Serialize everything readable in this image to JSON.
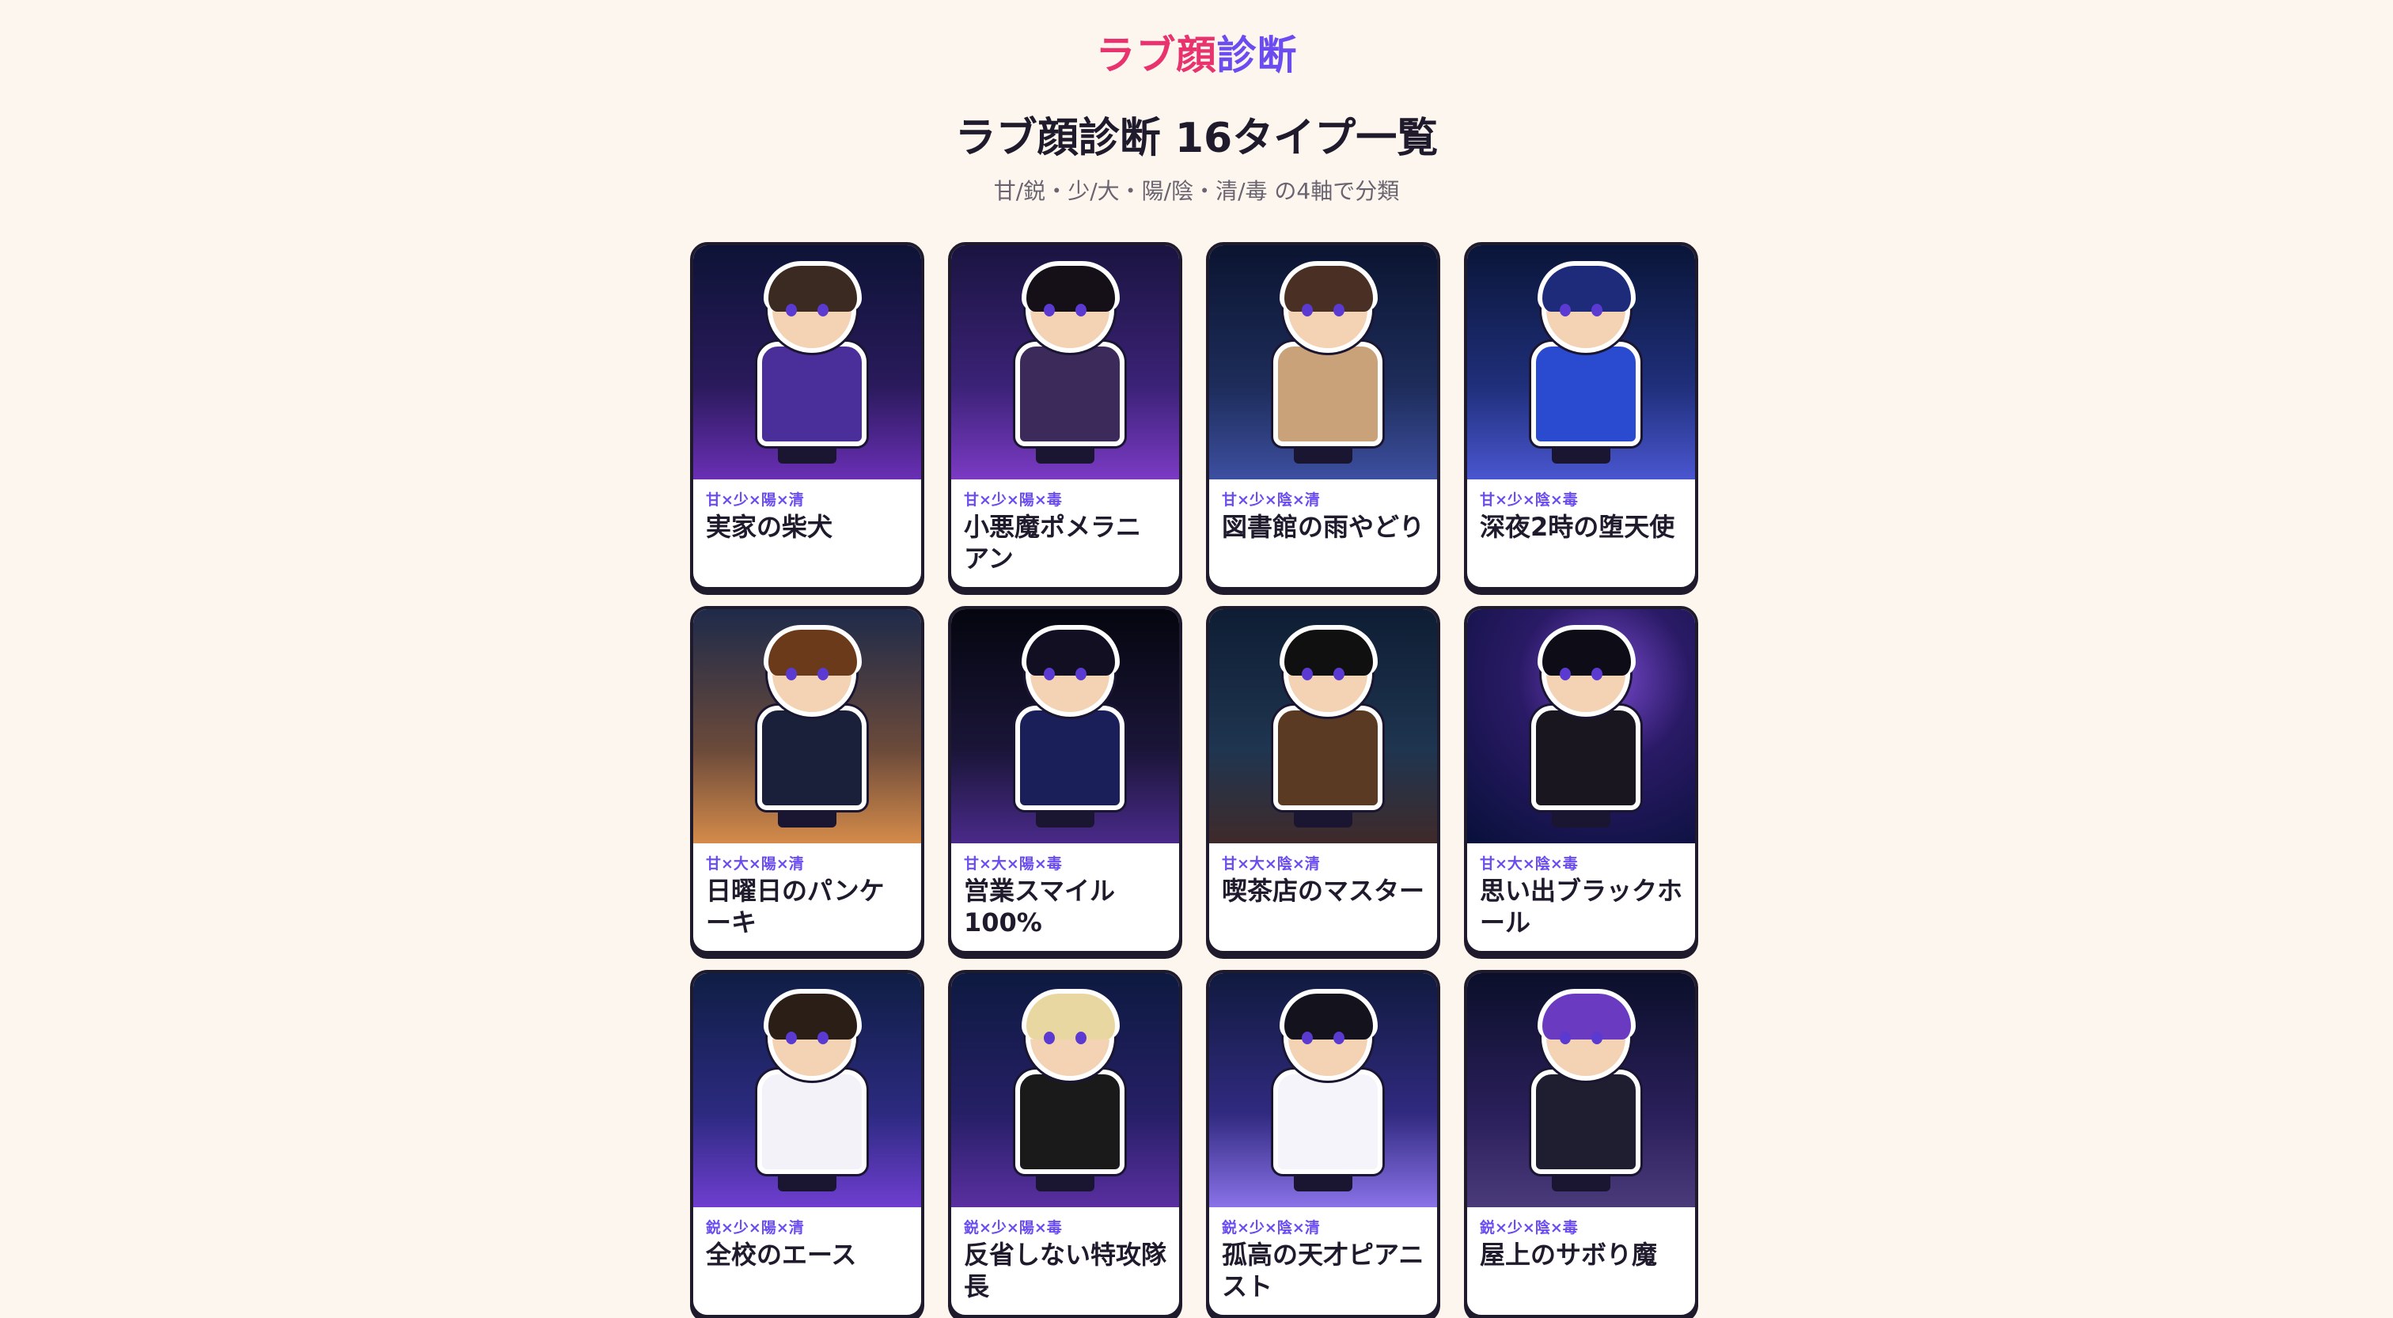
{
  "header": {
    "logo_part1": "ラブ顔",
    "logo_part2": "診断"
  },
  "page": {
    "title": "ラブ顔診断 16タイプ一覧",
    "subtitle": "甘/鋭・少/大・陽/陰・清/毒 の4軸で分類"
  },
  "colors": {
    "accent_pink": "#e8336e",
    "accent_purple": "#6a4cf0",
    "background": "#fdf6ee",
    "ink": "#1f1a2c"
  },
  "types": [
    {
      "tag": "甘×少×陽×清",
      "name": "実家の柴犬",
      "hair": "#3a2a22",
      "outfit": "#4a2f9a"
    },
    {
      "tag": "甘×少×陽×毒",
      "name": "小悪魔ポメラニアン",
      "hair": "#151018",
      "outfit": "#3b2a5a"
    },
    {
      "tag": "甘×少×陰×清",
      "name": "図書館の雨やどり",
      "hair": "#4a3024",
      "outfit": "#caa27a"
    },
    {
      "tag": "甘×少×陰×毒",
      "name": "深夜2時の堕天使",
      "hair": "#1e2a7a",
      "outfit": "#2a4ad0"
    },
    {
      "tag": "甘×大×陽×清",
      "name": "日曜日のパンケーキ",
      "hair": "#6a3a1a",
      "outfit": "#1a1f3a"
    },
    {
      "tag": "甘×大×陽×毒",
      "name": "営業スマイル100%",
      "hair": "#120f22",
      "outfit": "#1a1f5a"
    },
    {
      "tag": "甘×大×陰×清",
      "name": "喫茶店のマスター",
      "hair": "#101010",
      "outfit": "#5a3a22"
    },
    {
      "tag": "甘×大×陰×毒",
      "name": "思い出ブラックホール",
      "hair": "#0e0c16",
      "outfit": "#1a1620"
    },
    {
      "tag": "鋭×少×陽×清",
      "name": "全校のエース",
      "hair": "#2a1e16",
      "outfit": "#f2f2f8"
    },
    {
      "tag": "鋭×少×陽×毒",
      "name": "反省しない特攻隊長",
      "hair": "#e8d7a0",
      "outfit": "#1a1a1a"
    },
    {
      "tag": "鋭×少×陰×清",
      "name": "孤高の天才ピアニスト",
      "hair": "#14121c",
      "outfit": "#f4f4fa"
    },
    {
      "tag": "鋭×少×陰×毒",
      "name": "屋上のサボり魔",
      "hair": "#6a3ac0",
      "outfit": "#1e1e30"
    }
  ]
}
